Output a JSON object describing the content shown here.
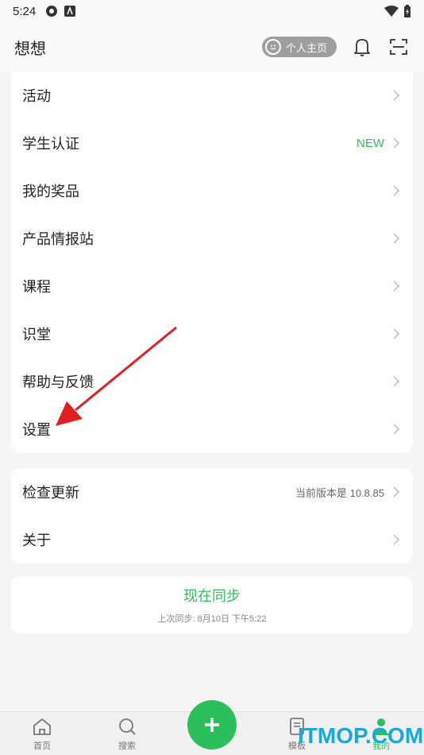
{
  "status_bar": {
    "time": "5:24"
  },
  "header": {
    "title": "想想",
    "profile_label": "个人主页"
  },
  "menu_main": [
    {
      "label": "活动"
    },
    {
      "label": "学生认证",
      "badge": "NEW"
    },
    {
      "label": "我的奖品"
    },
    {
      "label": "产品情报站"
    },
    {
      "label": "课程"
    },
    {
      "label": "识堂"
    },
    {
      "label": "帮助与反馈"
    },
    {
      "label": "设置"
    }
  ],
  "menu_secondary": [
    {
      "label": "检查更新",
      "meta": "当前版本是 10.8.85"
    },
    {
      "label": "关于"
    }
  ],
  "sync": {
    "button_label": "现在同步",
    "last_sync": "上次同步: 8月10日 下午5:22"
  },
  "tabs": {
    "home": "首页",
    "search": "搜索",
    "template": "模板",
    "me": "我的"
  },
  "watermark": "ITMOP.COM",
  "colors": {
    "accent": "#2bbf5b",
    "arrow": "#e02020",
    "watermark": "#1aa9d6"
  },
  "icons": [
    "status-gear-icon",
    "status-a-icon",
    "wifi-icon",
    "battery-icon",
    "smile-icon",
    "bell-icon",
    "scan-icon",
    "chevron-right-icon",
    "home-icon",
    "search-icon",
    "plus-icon",
    "template-icon",
    "person-icon"
  ]
}
